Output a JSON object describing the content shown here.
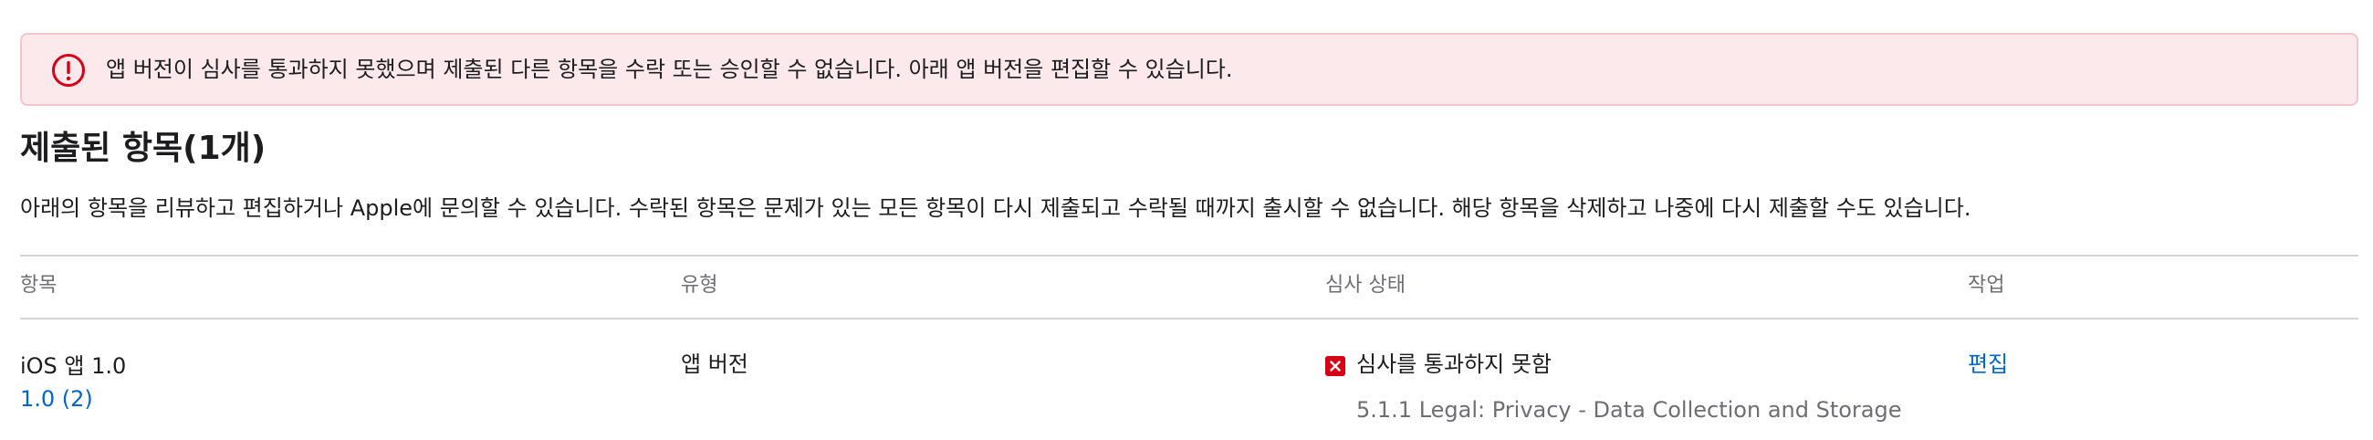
{
  "alert": {
    "icon": "exclamation-circle-icon",
    "color": "#d70015",
    "message": "앱 버전이 심사를 통과하지 못했으며 제출된 다른 항목을 수락 또는 승인할 수 없습니다. 아래 앱 버전을 편집할 수 있습니다."
  },
  "section": {
    "title": "제출된 항목(1개)",
    "description": "아래의 항목을 리뷰하고 편집하거나 Apple에 문의할 수 있습니다. 수락된 항목은 문제가 있는 모든 항목이 다시 제출되고 수락될 때까지 출시할 수 없습니다. 해당 항목을 삭제하고 나중에 다시 제출할 수도 있습니다."
  },
  "table": {
    "columns": [
      "항목",
      "유형",
      "심사 상태",
      "작업"
    ],
    "rows": [
      {
        "item_name": "iOS 앱 1.0",
        "item_version": "1.0 (2)",
        "type": "앱 버전",
        "status_icon": "x-mark-icon",
        "status": "심사를 통과하지 못함",
        "guideline": "5.1.1 Legal: Privacy - Data Collection and Storage",
        "action": "편집"
      }
    ]
  },
  "colors": {
    "link": "#0066cc",
    "error": "#d70015",
    "alert_background": "#fbe9eb",
    "alert_border": "#f3c6cc"
  }
}
